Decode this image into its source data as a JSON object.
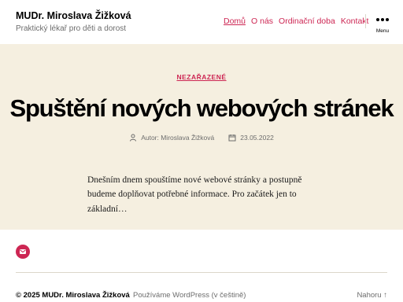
{
  "header": {
    "site_title": "MUDr. Miroslava Žižková",
    "site_description": "Praktický lékař pro děti a dorost",
    "nav": [
      {
        "label": "Domů"
      },
      {
        "label": "O nás"
      },
      {
        "label": "Ordinační doba"
      },
      {
        "label": "Kontakt"
      }
    ],
    "menu_label": "Menu"
  },
  "post": {
    "category": "NEZAŘAZENÉ",
    "title": "Spuštění nových webových stránek",
    "author": "Autor: Miroslava Žižková",
    "date": "23.05.2022",
    "excerpt": "Dnešním dnem spouštíme nové webové stránky a postupně budeme doplňovat potřebné informace. Pro začátek jen to základní…"
  },
  "footer": {
    "copyright": "© 2025 MUDr. Miroslava Žižková",
    "powered": "Používáme WordPress (v češtině)",
    "to_top": "Nahoru ↑"
  },
  "colors": {
    "accent": "#cd2653",
    "background": "#f5efe0",
    "header_bg": "#ffffff",
    "muted_text": "#6d6d6d"
  },
  "icons": {
    "author": "user-icon",
    "date": "calendar-icon",
    "widget": "mail-icon",
    "menu": "more-dots-icon"
  }
}
